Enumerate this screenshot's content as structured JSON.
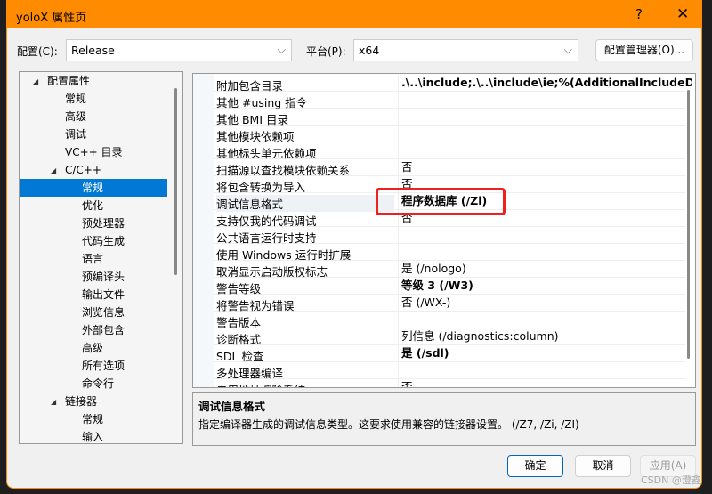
{
  "window": {
    "title": "yoloX 属性页",
    "help": "?",
    "close": "✕",
    "accent": "#ff8c00"
  },
  "config": {
    "label": "配置(C):",
    "value": "Release",
    "platform_label": "平台(P):",
    "platform_value": "x64",
    "manager_button": "配置管理器(O)..."
  },
  "tree": [
    {
      "label": "配置属性",
      "level": 0,
      "expanded": true
    },
    {
      "label": "常规",
      "level": 1
    },
    {
      "label": "高级",
      "level": 1
    },
    {
      "label": "调试",
      "level": 1
    },
    {
      "label": "VC++ 目录",
      "level": 1
    },
    {
      "label": "C/C++",
      "level": 1,
      "expanded": true
    },
    {
      "label": "常规",
      "level": 2,
      "selected": true
    },
    {
      "label": "优化",
      "level": 2
    },
    {
      "label": "预处理器",
      "level": 2
    },
    {
      "label": "代码生成",
      "level": 2
    },
    {
      "label": "语言",
      "level": 2
    },
    {
      "label": "预编译头",
      "level": 2
    },
    {
      "label": "输出文件",
      "level": 2
    },
    {
      "label": "浏览信息",
      "level": 2
    },
    {
      "label": "外部包含",
      "level": 2
    },
    {
      "label": "高级",
      "level": 2
    },
    {
      "label": "所有选项",
      "level": 2
    },
    {
      "label": "命令行",
      "level": 2
    },
    {
      "label": "链接器",
      "level": 1,
      "expanded": true
    },
    {
      "label": "常规",
      "level": 2
    },
    {
      "label": "输入",
      "level": 2
    }
  ],
  "properties": [
    {
      "name": "附加包含目录",
      "value": ".\\..\\include;.\\..\\include\\ie;%(AdditionalIncludeDirect",
      "bold": true
    },
    {
      "name": "其他 #using 指令",
      "value": ""
    },
    {
      "name": "其他 BMI 目录",
      "value": ""
    },
    {
      "name": "其他模块依赖项",
      "value": ""
    },
    {
      "name": "其他标头单元依赖项",
      "value": ""
    },
    {
      "name": "扫描源以查找模块依赖关系",
      "value": "否"
    },
    {
      "name": "将包含转换为导入",
      "value": "否"
    },
    {
      "name": "调试信息格式",
      "value": "程序数据库 (/Zi)",
      "bold": true,
      "selected": true
    },
    {
      "name": "支持仅我的代码调试",
      "value": "否"
    },
    {
      "name": "公共语言运行时支持",
      "value": ""
    },
    {
      "name": "使用 Windows 运行时扩展",
      "value": ""
    },
    {
      "name": "取消显示启动版权标志",
      "value": "是 (/nologo)"
    },
    {
      "name": "警告等级",
      "value": "等级 3 (/W3)",
      "bold": true
    },
    {
      "name": "将警告视为错误",
      "value": "否 (/WX-)"
    },
    {
      "name": "警告版本",
      "value": ""
    },
    {
      "name": "诊断格式",
      "value": "列信息 (/diagnostics:column)"
    },
    {
      "name": "SDL 检查",
      "value": "是 (/sdl)",
      "bold": true
    },
    {
      "name": "多处理器编译",
      "value": ""
    },
    {
      "name": "启用地址擦除系统",
      "value": "否"
    }
  ],
  "description": {
    "title": "调试信息格式",
    "text": "指定编译器生成的调试信息类型。这要求使用兼容的链接器设置。   (/Z7, /Zi, /ZI)"
  },
  "buttons": {
    "ok": "确定",
    "cancel": "取消",
    "apply": "应用(A)"
  },
  "watermark": "CSDN @澄鑫"
}
